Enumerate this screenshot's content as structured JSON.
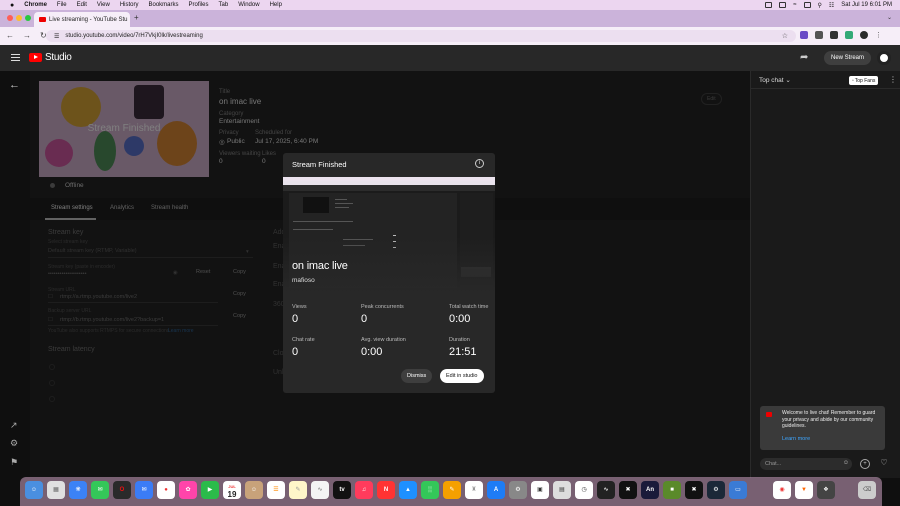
{
  "menubar": {
    "items": [
      "Chrome",
      "File",
      "Edit",
      "View",
      "History",
      "Bookmarks",
      "Profiles",
      "Tab",
      "Window",
      "Help"
    ],
    "datetime": "Sat Jul 19  6:01 PM"
  },
  "browser": {
    "tab_title": "Live streaming - YouTube Stu",
    "url": "studio.youtube.com/video/7rH7VkjI0lk/livestreaming"
  },
  "header": {
    "logo_text": "Studio",
    "new_stream_label": "New Stream"
  },
  "stream_info": {
    "thumbnail_text": "Stream Finished",
    "title_label": "Title",
    "title": "on imac live",
    "category_label": "Category",
    "category": "Entertainment",
    "privacy_label": "Privacy",
    "privacy": "Public",
    "scheduled_label": "Scheduled for",
    "scheduled": "Jul 17, 2025, 6:40 PM",
    "viewers_label": "Viewers waiting",
    "viewers": "0",
    "likes_label": "Likes",
    "likes": "0",
    "edit_label": "Edit",
    "status": "Offline"
  },
  "tabs": [
    "Stream settings",
    "Analytics",
    "Stream health"
  ],
  "settings": {
    "stream_key_heading": "Stream key",
    "stream_key_select_label": "Select stream key",
    "stream_key_select_value": "Default stream key (RTMP, Variable)",
    "stream_key_label": "Stream key (paste in encoder)",
    "stream_key_mask": "••••••••••••••••••••",
    "reset_label": "Reset",
    "copy_label": "Copy",
    "stream_url_label": "Stream URL",
    "stream_url": "rtmp://a.rtmp.youtube.com/live2",
    "backup_url_label": "Backup server URL",
    "backup_url": "rtmp://b.rtmp.youtube.com/live2?backup=1",
    "rtmps_note": "YouTube also supports RTMPS for secure connections.",
    "learn_more": "Learn more",
    "latency_heading": "Stream latency",
    "right_labels": [
      "Add",
      "Ena",
      "Ena",
      "Ena",
      "360",
      "Clo",
      "Unl"
    ]
  },
  "dialog": {
    "title": "Stream Finished",
    "stream_title": "on imac live",
    "channel": "mafioso",
    "stats": [
      {
        "label": "Views",
        "value": "0"
      },
      {
        "label": "Peak concurrents",
        "value": "0"
      },
      {
        "label": "Total watch time",
        "value": "0:00"
      },
      {
        "label": "Chat rate",
        "value": "0"
      },
      {
        "label": "Avg. view duration",
        "value": "0:00"
      },
      {
        "label": "Duration",
        "value": "21:51"
      }
    ],
    "dismiss_label": "Dismiss",
    "edit_label": "Edit in studio"
  },
  "chat": {
    "mode": "Top chat",
    "top_fans_label": "Top Fans",
    "welcome_text": "Welcome to live chat! Remember to guard your privacy and abide by our community guidelines.",
    "learn_more": "Learn more",
    "input_placeholder": "Chat..."
  },
  "dock": {
    "calendar_day": "19",
    "calendar_month": "JUL"
  }
}
